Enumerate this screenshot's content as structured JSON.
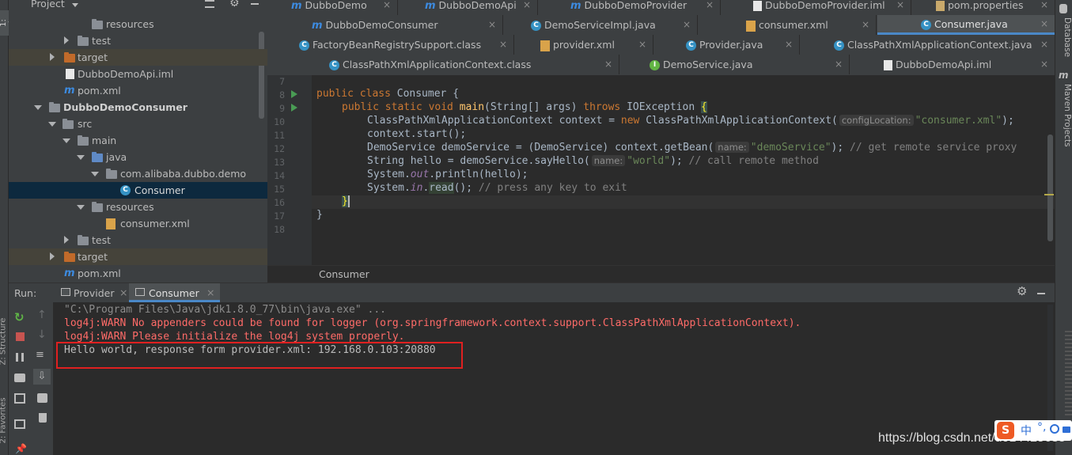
{
  "left_strip": {
    "project_label": "1: Project",
    "structure_label": "Z: Structure",
    "favorites_label": "2: Favorites"
  },
  "project_panel": {
    "title": "Project",
    "tree": [
      {
        "label": "resources",
        "icon": "folder-icon"
      },
      {
        "label": "test",
        "icon": "folder-icon"
      },
      {
        "label": "target",
        "icon": "folder-orange-icon"
      },
      {
        "label": "DubboDemoApi.iml",
        "icon": "iml-file-icon"
      },
      {
        "label": "pom.xml",
        "icon": "maven-icon"
      },
      {
        "label": "DubboDemoConsumer",
        "icon": "module-folder-icon"
      },
      {
        "label": "src",
        "icon": "folder-icon"
      },
      {
        "label": "main",
        "icon": "folder-icon"
      },
      {
        "label": "java",
        "icon": "folder-blue-icon"
      },
      {
        "label": "com.alibaba.dubbo.demo",
        "icon": "package-icon"
      },
      {
        "label": "Consumer",
        "icon": "class-icon"
      },
      {
        "label": "resources",
        "icon": "folder-icon"
      },
      {
        "label": "consumer.xml",
        "icon": "xml-file-icon"
      },
      {
        "label": "test",
        "icon": "folder-icon"
      },
      {
        "label": "target",
        "icon": "folder-orange-icon"
      },
      {
        "label": "pom.xml",
        "icon": "maven-icon"
      }
    ]
  },
  "editor_tabs": {
    "row1": [
      "DubboDemo",
      "DubboDemoApi",
      "DubboDemoProvider",
      "DubboDemoProvider.iml",
      "pom.properties"
    ],
    "row2": [
      "DubboDemoConsumer",
      "DemoServiceImpl.java",
      "consumer.xml",
      "Consumer.java"
    ],
    "row3": [
      "FactoryBeanRegistrySupport.class",
      "provider.xml",
      "Provider.java",
      "ClassPathXmlApplicationContext.java"
    ],
    "row4": [
      "ClassPathXmlApplicationContext.class",
      "DemoService.java",
      "DubboDemoApi.iml"
    ]
  },
  "editor": {
    "line_numbers": [
      "7",
      "8",
      "9",
      "10",
      "11",
      "12",
      "13",
      "14",
      "15",
      "16",
      "17",
      "18"
    ],
    "code": {
      "l8_kw": "public class ",
      "l8_name": "Consumer {",
      "l9_kw": "public static void ",
      "l9_fn": "main",
      "l9_args": "(String[] args) ",
      "l9_throws": "throws ",
      "l9_exc": "IOException ",
      "l9_brace": "{",
      "l10_a": "ClassPathXmlApplicationContext context = ",
      "l10_new": "new ",
      "l10_b": "ClassPathXmlApplicationContext(",
      "l10_hint": "configLocation:",
      "l10_str": "\"consumer.xml\"",
      "l10_c": ");",
      "l11": "context.start();",
      "l12_a": "DemoService demoService = (DemoService) context.getBean(",
      "l12_hint": "name:",
      "l12_str": "\"demoService\"",
      "l12_b": "); ",
      "l12_cm": "// get remote service proxy",
      "l13_a": "String hello = demoService.sayHello(",
      "l13_hint": "name:",
      "l13_str": "\"world\"",
      "l13_b": "); ",
      "l13_cm": "// call remote method",
      "l14_a": "System.",
      "l14_out": "out",
      "l14_b": ".println(hello);",
      "l15_a": "System.",
      "l15_in": "in",
      "l15_dot": ".",
      "l15_read": "read",
      "l15_b": "(); ",
      "l15_cm": "// press any key to exit",
      "l16": "}",
      "l17": "}"
    },
    "breadcrumb": "Consumer"
  },
  "right_strip": {
    "database": "Database",
    "maven": "Maven Projects"
  },
  "run_panel": {
    "label": "Run:",
    "tabs": [
      "Provider",
      "Consumer"
    ],
    "output": [
      {
        "text": "\"C:\\Program Files\\Java\\jdk1.8.0_77\\bin\\java.exe\" ...",
        "color": "#8c8c8c"
      },
      {
        "text": "log4j:WARN No appenders could be found for logger (org.springframework.context.support.ClassPathXmlApplicationContext).",
        "color": "#ff6b68"
      },
      {
        "text": "log4j:WARN Please initialize the log4j system properly.",
        "color": "#ff6b68"
      },
      {
        "text": "Hello world, response form provider.xml: 192.168.0.103:20880",
        "color": "#bbbbbb"
      }
    ]
  },
  "watermark": "https://blog.csdn.net/u014425638",
  "ime_label": "中"
}
